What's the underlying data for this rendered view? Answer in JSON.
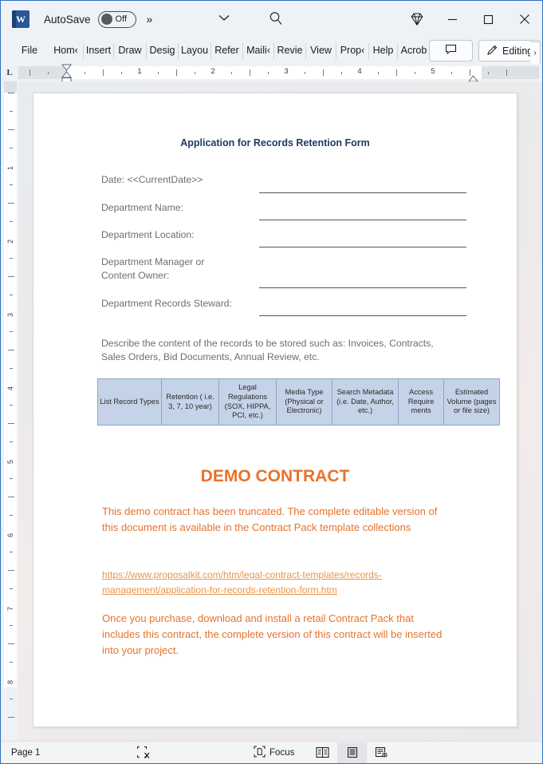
{
  "titlebar": {
    "app_icon": "word-logo",
    "autosave_label": "AutoSave",
    "autosave_state": "Off",
    "overflow_label": "»",
    "customize_icon": "chevron-down-icon",
    "search_icon": "search-icon",
    "copilot_icon": "copilot-diamond-icon",
    "minimize_icon": "minimize-icon",
    "maximize_icon": "maximize-icon",
    "close_icon": "close-icon"
  },
  "ribbon": {
    "tabs": [
      {
        "label": "File",
        "width": 48
      },
      {
        "label": "Hom‹",
        "width": 44
      },
      {
        "label": "Insert",
        "width": 38
      },
      {
        "label": "Draw",
        "width": 41
      },
      {
        "label": "Desig",
        "width": 40
      },
      {
        "label": "Layou",
        "width": 41
      },
      {
        "label": "Refer",
        "width": 40
      },
      {
        "label": "Maili‹",
        "width": 39
      },
      {
        "label": "Revie",
        "width": 40
      },
      {
        "label": "View",
        "width": 38
      },
      {
        "label": "Prop‹",
        "width": 41
      },
      {
        "label": "Help",
        "width": 36
      },
      {
        "label": "Acrob",
        "width": 40
      }
    ],
    "comment_icon": "comment-icon",
    "editing_icon": "pencil-icon",
    "editing_label": "Editing",
    "overflow_chevron": "›"
  },
  "ruler": {
    "tab_stop_marker": "L",
    "h_numbers": [
      "1",
      "2",
      "3",
      "4",
      "5"
    ],
    "v_numbers": [
      "1",
      "2",
      "3",
      "4",
      "5",
      "6",
      "7",
      "8"
    ]
  },
  "document": {
    "title": "Application for Records Retention Form",
    "title_color": "#1f3864",
    "form_fields": [
      {
        "label": "Date: <<CurrentDate>>",
        "two_line": false
      },
      {
        "label": "Department Name:",
        "two_line": false
      },
      {
        "label": "Department Location:",
        "two_line": false
      },
      {
        "label": "Department Manager or\nContent Owner:",
        "two_line": true
      },
      {
        "label": "Department Records Steward:",
        "two_line": false
      }
    ],
    "describe_text": "Describe the content of the records to be stored such as: Invoices, Contracts, Sales Orders, Bid Documents, Annual Review, etc.",
    "table": {
      "fill_color": "#c5d3e8",
      "border_color": "#8ea4c4",
      "headers": [
        "List Record Types",
        "Retention ( i.e. 3, 7, 10 year)",
        "Legal Regulations (SOX, HIPPA, PCI, etc.)",
        "Media Type (Physical or Electronic)",
        "Search Metadata (i.e. Date, Author, etc.)",
        "Access Require ments",
        "Estimated Volume (pages or file size)"
      ],
      "widths": [
        80,
        72,
        72,
        70,
        83,
        57,
        70
      ]
    },
    "demo": {
      "heading": "DEMO CONTRACT",
      "heading_color": "#e8722a",
      "paragraph_1": "This demo contract has been truncated. The complete editable version of this document is available in the Contract Pack template collections",
      "link": "https://www.proposalkit.com/htm/legal-contract-templates/records-management/application-for-records-retention-form.htm",
      "link_color": "#e8954a",
      "paragraph_2": "Once you purchase, download and install a retail Contract Pack that includes this contract, the complete version of this contract will be inserted into your project."
    }
  },
  "statusbar": {
    "page_label": "Page 1",
    "proofing_icon": "proofing-errors-icon",
    "focus_icon": "focus-icon",
    "focus_label": "Focus",
    "view_read_icon": "read-mode-icon",
    "view_print_icon": "print-layout-icon",
    "view_web_icon": "web-layout-icon",
    "active_view": "print-layout-icon"
  }
}
